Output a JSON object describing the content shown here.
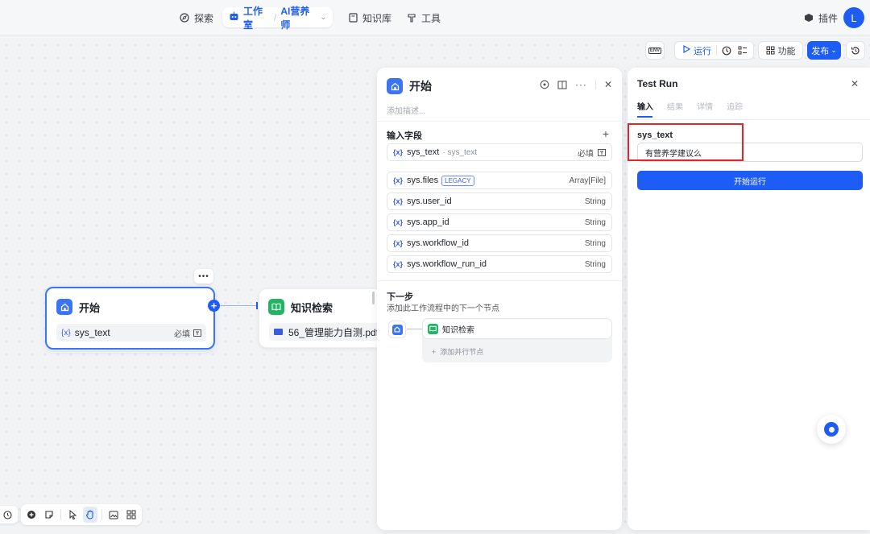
{
  "topnav": {
    "explore": "探索",
    "studio": "工作室",
    "app_name": "AI营养师",
    "knowledge": "知识库",
    "tools": "工具",
    "plugins": "插件",
    "avatar": "L"
  },
  "toolbar": {
    "env": "ENV",
    "run": "运行",
    "features": "功能",
    "publish": "发布"
  },
  "canvas": {
    "start_node": {
      "title": "开始",
      "var_prefix": "{x}",
      "var_name": "sys_text",
      "required": "必填"
    },
    "kb_node": {
      "title": "知识检索",
      "file": "56_管理能力自测.pdf..."
    }
  },
  "panel": {
    "title": "开始",
    "description_placeholder": "添加描述...",
    "input_fields_title": "输入字段",
    "fields": [
      {
        "name": "sys_text",
        "sub": "sys_text",
        "type": "必填"
      },
      {
        "name": "sys.files",
        "legacy": "LEGACY",
        "type": "Array[File]"
      },
      {
        "name": "sys.user_id",
        "type": "String"
      },
      {
        "name": "sys.app_id",
        "type": "String"
      },
      {
        "name": "sys.workflow_id",
        "type": "String"
      },
      {
        "name": "sys.workflow_run_id",
        "type": "String"
      }
    ],
    "var_prefix": "{x}",
    "next_step_title": "下一步",
    "next_step_desc": "添加此工作流程中的下一个节点",
    "next_node": "知识检索",
    "add_parallel": "添加并行节点"
  },
  "test_run": {
    "title": "Test Run",
    "tabs": [
      "输入",
      "结果",
      "详情",
      "追踪"
    ],
    "label": "sys_text",
    "input_value": "有营养学建议么",
    "run_button": "开始运行"
  },
  "colors": {
    "accent": "#1d5cf5",
    "highlight": "#e0262a",
    "kb_green": "#21b463"
  }
}
